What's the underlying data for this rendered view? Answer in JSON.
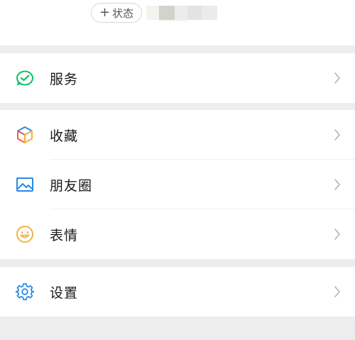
{
  "header": {
    "status_plus": "+",
    "status_label": "状态"
  },
  "menu": {
    "services": {
      "label": "服务",
      "icon": "services-wallet-icon",
      "color": "#07c160"
    },
    "favorites": {
      "label": "收藏",
      "icon": "favorites-cube-icon"
    },
    "moments": {
      "label": "朋友圈",
      "icon": "moments-picture-icon",
      "color": "#2b8ae7"
    },
    "stickers": {
      "label": "表情",
      "icon": "stickers-smiley-icon",
      "color": "#f2b33d"
    },
    "settings": {
      "label": "设置",
      "icon": "settings-gear-icon",
      "color": "#2b8ae7"
    }
  },
  "colors": {
    "background": "#ededed",
    "card": "#ffffff",
    "chevron": "#b2b2b2"
  }
}
